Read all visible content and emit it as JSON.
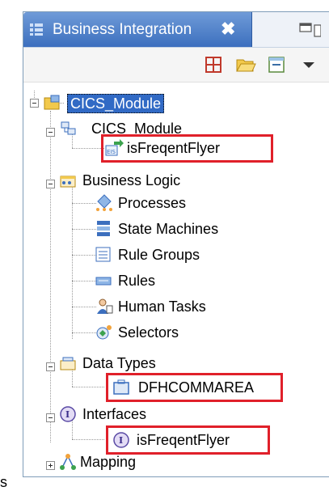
{
  "view": {
    "tab_title": "Business Integration",
    "close_glyph": "✖"
  },
  "tree": {
    "root": "CICS_Module",
    "module_node": "CICS_Module",
    "module_child": "isFreqentFlyer",
    "business_logic": "Business Logic",
    "bl_children": [
      "Processes",
      "State Machines",
      "Rule Groups",
      "Rules",
      "Human Tasks",
      "Selectors"
    ],
    "data_types": "Data Types",
    "data_types_child": "DFHCOMMAREA",
    "interfaces": "Interfaces",
    "interfaces_child": "isFreqentFlyer",
    "mapping": "Mapping"
  },
  "left_edge_glyph": "s",
  "colors": {
    "highlight": "#e0202a",
    "selection": "#316ac5",
    "tab": "#3c6fbe"
  }
}
